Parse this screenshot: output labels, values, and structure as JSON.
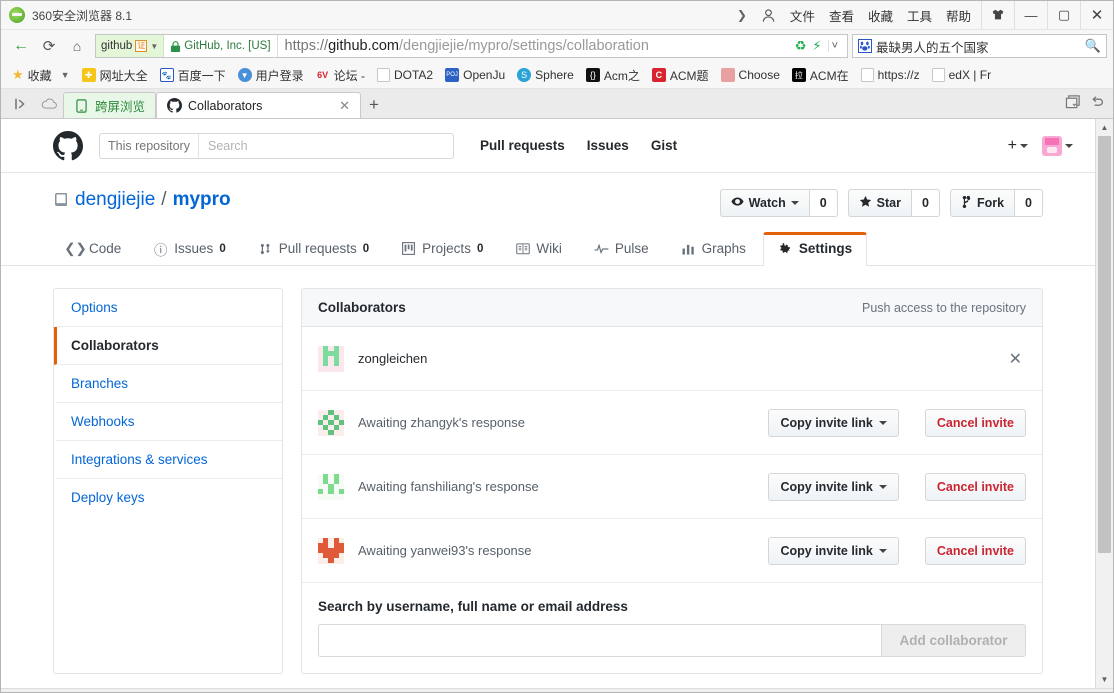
{
  "window": {
    "title": "360安全浏览器 8.1",
    "menu": [
      "文件",
      "查看",
      "收藏",
      "工具",
      "帮助"
    ],
    "controls": {
      "skin": "skin-icon",
      "minimize": "—",
      "maximize": "▢",
      "close": "✕"
    }
  },
  "navbar": {
    "back": "←",
    "reload": "⟳",
    "home": "⌂",
    "site_badge": {
      "name": "github",
      "cert": "证"
    },
    "security": {
      "label": "GitHub, Inc. [US]"
    },
    "url": {
      "scheme": "https://",
      "host": "github.com",
      "path": "/dengjiejie/mypro/settings/collaboration"
    },
    "search": {
      "engine": "baidu-icon",
      "value": "最缺男人的五个国家"
    }
  },
  "bookmarks": {
    "favorites_label": "收藏",
    "items": [
      {
        "label": "网址大全",
        "icon": "hao123-icon",
        "color": "#f5c518",
        "glyph": "✚"
      },
      {
        "label": "百度一下",
        "icon": "baidu-icon",
        "color": "#2c55c9",
        "glyph": "熊"
      },
      {
        "label": "用户登录",
        "icon": "user-login-icon",
        "color": "#4a90d9",
        "glyph": "▼"
      },
      {
        "label": "论坛 -",
        "icon": "forum-icon",
        "color": "#d9232e",
        "glyph": "6V"
      },
      {
        "label": "DOTA2",
        "icon": "page-icon",
        "color": "#ffffff",
        "glyph": ""
      },
      {
        "label": "OpenJu",
        "icon": "openju-icon",
        "color": "#2d62c4",
        "glyph": "POJ"
      },
      {
        "label": "Sphere",
        "icon": "sphere-icon",
        "color": "#2aa3d8",
        "glyph": "S"
      },
      {
        "label": "Acm之",
        "icon": "acm-code-icon",
        "color": "#111111",
        "glyph": "{}"
      },
      {
        "label": "ACM题",
        "icon": "acm-red-icon",
        "color": "#d9232e",
        "glyph": "C"
      },
      {
        "label": "Choose",
        "icon": "choose-icon",
        "color": "#e8a0a0",
        "glyph": ""
      },
      {
        "label": "ACM在",
        "icon": "acm-black-icon",
        "color": "#000000",
        "glyph": "拉"
      },
      {
        "label": "https://z",
        "icon": "page-icon",
        "color": "#ffffff",
        "glyph": ""
      },
      {
        "label": "edX | Fr",
        "icon": "page-icon",
        "color": "#ffffff",
        "glyph": ""
      }
    ]
  },
  "tabbar": {
    "sidebar_toggle": "⊳",
    "cloud": "cloud-icon",
    "tabs": [
      {
        "label": "跨屏浏览",
        "type": "green",
        "icon": "phone-icon"
      },
      {
        "label": "Collaborators",
        "type": "active",
        "icon": "github-icon",
        "close": "✕"
      }
    ],
    "new_tab": "+",
    "right_icons": [
      "tab-list-icon",
      "restore-tab-icon"
    ]
  },
  "github": {
    "header": {
      "logo": "github-mark-icon",
      "search_scope": "This repository",
      "search_placeholder": "Search",
      "nav": [
        "Pull requests",
        "Issues",
        "Gist"
      ],
      "plus": "+",
      "avatar": "user-avatar"
    },
    "repo": {
      "owner": "dengjiejie",
      "separator": "/",
      "name": "mypro",
      "actions": [
        {
          "label": "Watch",
          "count": "0",
          "icon": "eye-icon",
          "caret": true
        },
        {
          "label": "Star",
          "count": "0",
          "icon": "star-icon",
          "caret": false
        },
        {
          "label": "Fork",
          "count": "0",
          "icon": "fork-icon",
          "caret": false
        }
      ]
    },
    "repo_nav": [
      {
        "label": "Code",
        "icon": "code-icon",
        "count": "",
        "active": false
      },
      {
        "label": "Issues",
        "icon": "issue-opened-icon",
        "count": "0",
        "active": false
      },
      {
        "label": "Pull requests",
        "icon": "git-pull-request-icon",
        "count": "0",
        "active": false
      },
      {
        "label": "Projects",
        "icon": "project-icon",
        "count": "0",
        "active": false
      },
      {
        "label": "Wiki",
        "icon": "book-icon",
        "count": "",
        "active": false
      },
      {
        "label": "Pulse",
        "icon": "pulse-icon",
        "count": "",
        "active": false
      },
      {
        "label": "Graphs",
        "icon": "graph-icon",
        "count": "",
        "active": false
      },
      {
        "label": "Settings",
        "icon": "gear-icon",
        "count": "",
        "active": true
      }
    ],
    "settings_menu": [
      {
        "label": "Options",
        "active": false
      },
      {
        "label": "Collaborators",
        "active": true
      },
      {
        "label": "Branches",
        "active": false
      },
      {
        "label": "Webhooks",
        "active": false
      },
      {
        "label": "Integrations & services",
        "active": false
      },
      {
        "label": "Deploy keys",
        "active": false
      }
    ],
    "collaborators": {
      "title": "Collaborators",
      "subtitle": "Push access to the repository",
      "rows": [
        {
          "name": "zongleichen",
          "pending": false,
          "remove_icon": "✕",
          "avatar_color": "#7bdc9e",
          "avatar_bg": "#fce8ec"
        },
        {
          "name": "Awaiting zhangyk's response",
          "pending": true,
          "copy_label": "Copy invite link",
          "cancel_label": "Cancel invite",
          "avatar_color": "#5ec37e",
          "avatar_bg": "#fdecec"
        },
        {
          "name": "Awaiting fanshiliang's response",
          "pending": true,
          "copy_label": "Copy invite link",
          "cancel_label": "Cancel invite",
          "avatar_color": "#7ddb8e",
          "avatar_bg": "#f6fbf6"
        },
        {
          "name": "Awaiting yanwei93's response",
          "pending": true,
          "copy_label": "Copy invite link",
          "cancel_label": "Cancel invite",
          "avatar_color": "#e05a3a",
          "avatar_bg": "#fdeee8"
        }
      ],
      "footer": {
        "label": "Search by username, full name or email address",
        "input_value": "",
        "add_button": "Add collaborator"
      }
    }
  },
  "colors": {
    "accent_orange": "#e36209",
    "link_blue": "#0366d6",
    "danger_red": "#cb2431",
    "github_dark": "#24292e"
  }
}
